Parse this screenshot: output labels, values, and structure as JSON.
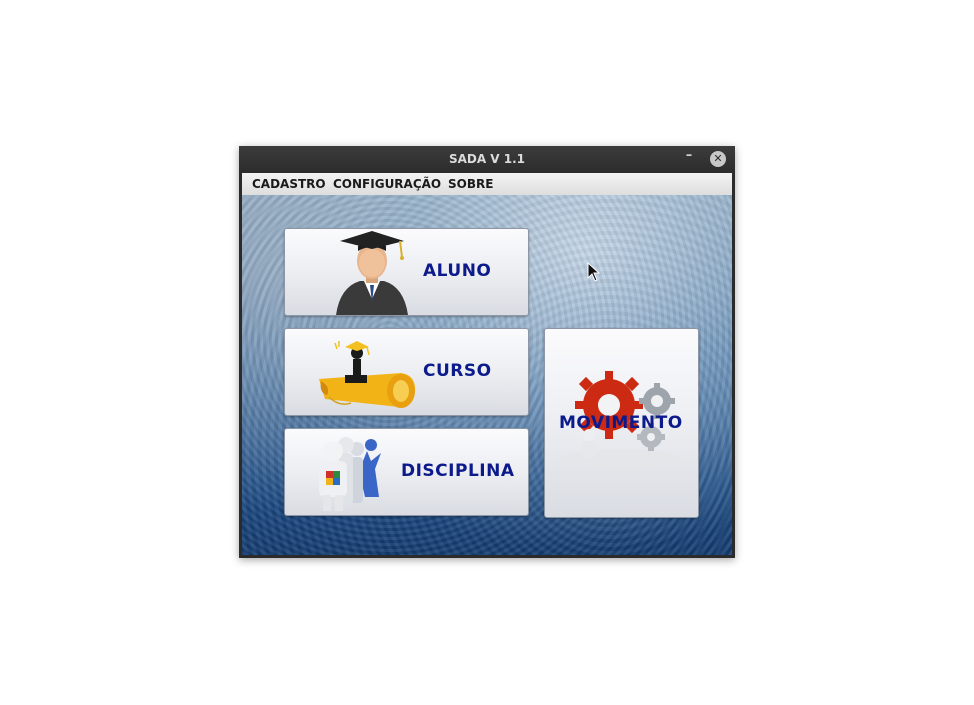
{
  "window": {
    "title": "SADA V 1.1",
    "minimize_label": "–",
    "close_label": "✕"
  },
  "menu": {
    "items": [
      "CADASTRO",
      "CONFIGURAÇÃO",
      "SOBRE"
    ]
  },
  "tiles": {
    "aluno": {
      "label": "ALUNO",
      "icon": "graduate-icon"
    },
    "curso": {
      "label": "CURSO",
      "icon": "diploma-icon"
    },
    "disciplina": {
      "label": "DISCIPLINA",
      "icon": "team-puzzle-icon"
    },
    "movimento": {
      "label": "MOVIMENTO",
      "icon": "gears-icon"
    }
  },
  "colors": {
    "label": "#0c1a8c",
    "gear_red": "#cc2a12",
    "diploma_gold": "#f2b316"
  }
}
